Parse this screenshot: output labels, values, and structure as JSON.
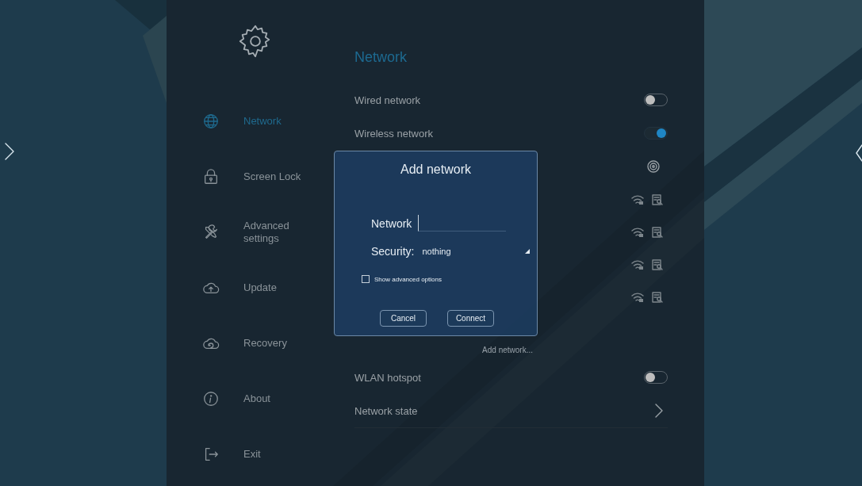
{
  "sidebar": {
    "items": [
      {
        "label": "Network",
        "selected": true
      },
      {
        "label": "Screen Lock",
        "selected": false
      },
      {
        "label": "Advanced settings",
        "selected": false
      },
      {
        "label": "Update",
        "selected": false
      },
      {
        "label": "Recovery",
        "selected": false
      },
      {
        "label": "About",
        "selected": false
      },
      {
        "label": "Exit",
        "selected": false
      }
    ]
  },
  "content": {
    "title": "Network",
    "rows": [
      {
        "kind": "toggle",
        "label": "Wired network",
        "on": false
      },
      {
        "kind": "toggle",
        "label": "Wireless network",
        "on": true
      },
      {
        "kind": "scan"
      },
      {
        "kind": "wifi"
      },
      {
        "kind": "wifi"
      },
      {
        "kind": "wifi"
      },
      {
        "kind": "wifi"
      },
      {
        "kind": "add",
        "label": "Add network..."
      },
      {
        "kind": "toggle",
        "label": "WLAN hotspot",
        "on": false
      },
      {
        "kind": "link",
        "label": "Network state"
      }
    ]
  },
  "dialog": {
    "title": "Add network",
    "network_label": "Network",
    "security_label": "Security:",
    "security_value": "nothing",
    "advanced": {
      "label": "Show advanced options",
      "checked": false
    },
    "buttons": [
      "Cancel",
      "Connect"
    ]
  }
}
